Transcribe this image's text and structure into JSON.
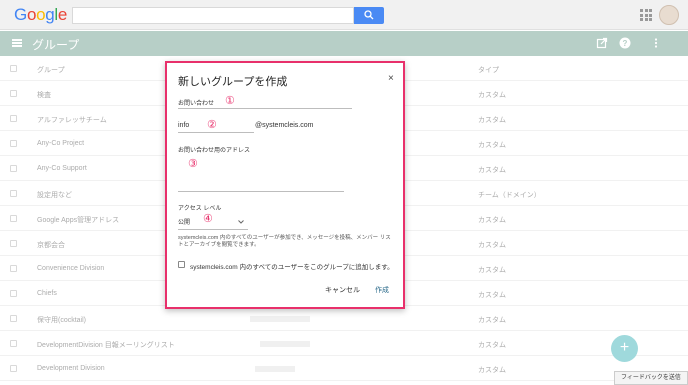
{
  "logo": {
    "letters": [
      "G",
      "o",
      "o",
      "g",
      "l",
      "e"
    ],
    "colors": [
      "#4285f4",
      "#ea4335",
      "#fbbc05",
      "#4285f4",
      "#34a853",
      "#ea4335"
    ]
  },
  "header": {
    "title": "グループ",
    "bg_color": "#b7cfc7"
  },
  "list": {
    "rows": [
      {
        "name": "グループ",
        "type": "タイプ"
      },
      {
        "name": "検査",
        "type": "カスタム"
      },
      {
        "name": "アルファレッサチーム",
        "type": "カスタム"
      },
      {
        "name": "Any-Co Project",
        "type": "カスタム"
      },
      {
        "name": "Any-Co Support",
        "type": "カスタム"
      },
      {
        "name": "設定用など",
        "type": "チーム（ドメイン）"
      },
      {
        "name": "Google Apps管理アドレス",
        "type": "カスタム"
      },
      {
        "name": "京都会合",
        "type": "カスタム"
      },
      {
        "name": "Convenience Division",
        "type": "カスタム"
      },
      {
        "name": "Chiefs",
        "type": "カスタム"
      },
      {
        "name": "保守用(cocktail)",
        "type": "カスタム"
      },
      {
        "name": "DevelopmentDivision 目報メーリングリスト",
        "type": "カスタム"
      },
      {
        "name": "Development Division",
        "type": "カスタム"
      }
    ]
  },
  "dialog": {
    "title": "新しいグループを作成",
    "close": "×",
    "name_label": "お問い合わせ",
    "email_value": "info",
    "email_domain": "@systemcleis.com",
    "description_label": "お問い合わせ用のアドレス",
    "access_label": "アクセス レベル",
    "access_value": "公開",
    "access_desc": "systemcleis.com 内のすべてのユーザーが参加でき、メッセージを投稿、メンバー リストとアーカイブを閲覧できます。",
    "add_all_label": "systemcleis.com 内のすべてのユーザーをこのグループに追加します。",
    "cancel": "キャンセル",
    "create": "作成",
    "markers": [
      "①",
      "②",
      "③",
      "④"
    ],
    "accent_color": "#e8306b"
  },
  "fab": {
    "label": "+"
  },
  "feedback": {
    "label": "フィードバックを送信"
  }
}
